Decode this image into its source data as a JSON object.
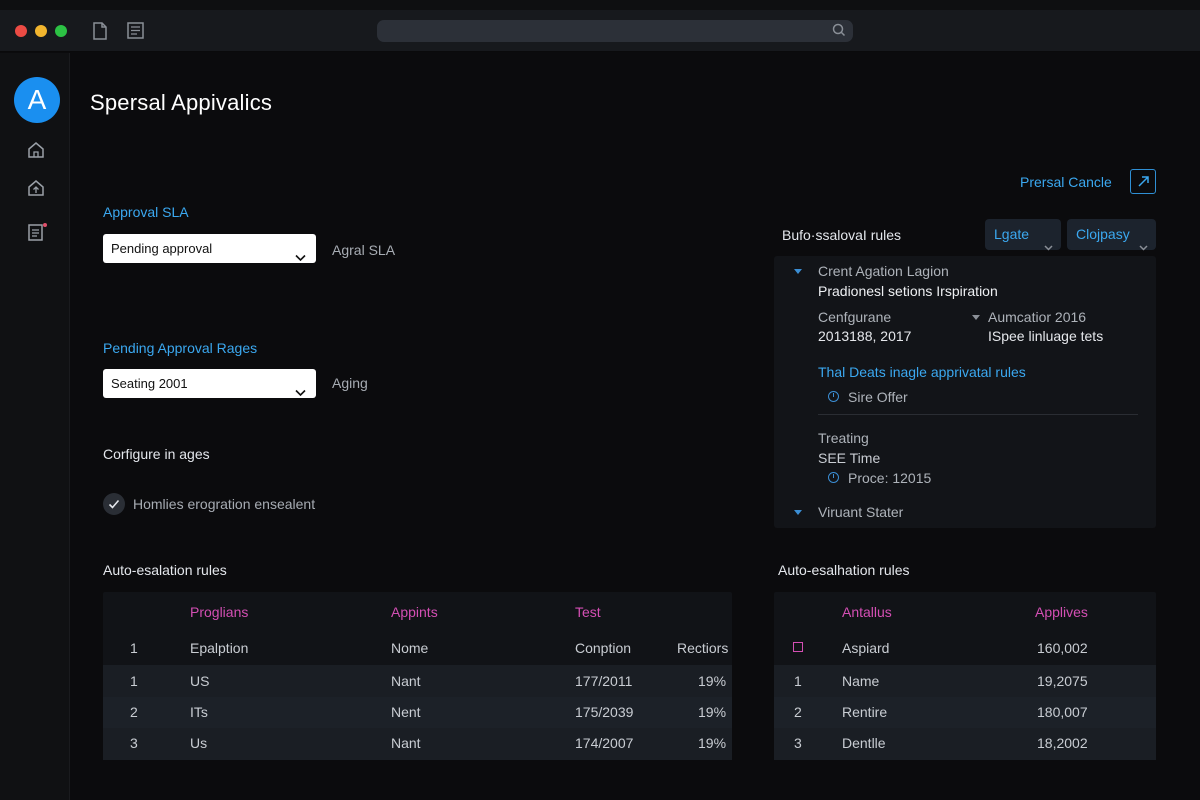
{
  "window": {
    "search_placeholder": ""
  },
  "sidebar": {
    "avatar_letter": "A"
  },
  "header": {
    "title": "Spersal Appivalics"
  },
  "left": {
    "approval_sla_label": "Approval SLA",
    "approval_sla_select": "Pending approval",
    "approval_sla_side": "Agral SLA",
    "pending_ranges_label": "Pending Approval Rages",
    "pending_ranges_select": "Seating 2001",
    "pending_ranges_side": "Aging",
    "configure_label": "Corfigure in ages",
    "checkbox_label": "Homlies erogration ensealent",
    "auto_escalation_title": "Auto-esalation rules"
  },
  "right": {
    "cancel_link": "Prersal Cancle",
    "rules_title": "Bufo·ssalovaI rules",
    "pill_1": "Lgate",
    "pill_2": "Clojpasy",
    "tree": {
      "item1_title": "Crent Agation Lagion",
      "item1_sub": "Pradionesl setions Irspiration",
      "col_a_label": "Cenfgurane",
      "col_a_value": "2013188, 2017",
      "col_b_label": "Aumcatior 2016",
      "col_b_value": "ISpee linluage tets",
      "link_text": "Thal Deats inagle apprivatal rules",
      "link_sub": "Sire Offer",
      "treating": "Treating",
      "see_time": "SEE Time",
      "proce": "Proce: 12015",
      "last_item": "Viruant Stater"
    },
    "auto_escalation_title": "Auto-esalhation rules"
  },
  "table_left": {
    "headers": [
      "Proglians",
      "Appints",
      "Test"
    ],
    "subheader": [
      "1",
      "Epalption",
      "Nome",
      "Conption",
      "Rectiors"
    ],
    "rows": [
      [
        "1",
        "US",
        "Nant",
        "177/2011",
        "19%"
      ],
      [
        "2",
        "ITs",
        "Nent",
        "175/2039",
        "19%"
      ],
      [
        "3",
        "Us",
        "Nant",
        "174/2007",
        "19%"
      ]
    ]
  },
  "table_right": {
    "headers": [
      "Antallus",
      "Applives"
    ],
    "subheader": [
      "Aspiard",
      "160,002"
    ],
    "rows": [
      [
        "1",
        "Name",
        "19,2075"
      ],
      [
        "2",
        "Rentire",
        "180,007"
      ],
      [
        "3",
        "Dentlle",
        "18,2002"
      ]
    ]
  },
  "colors": {
    "accent_blue": "#3ba8f0",
    "header_magenta": "#d44fb4",
    "background": "#0b0b0d"
  }
}
